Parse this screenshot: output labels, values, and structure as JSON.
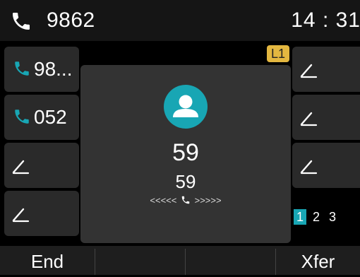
{
  "status_bar": {
    "extension": "9862",
    "time": "14 : 31"
  },
  "line_keys_left": [
    {
      "type": "phone",
      "label": "98..."
    },
    {
      "type": "phone",
      "label": "052"
    },
    {
      "type": "empty",
      "label": ""
    },
    {
      "type": "empty",
      "label": ""
    }
  ],
  "line_keys_right": [
    {
      "type": "empty",
      "label": ""
    },
    {
      "type": "empty",
      "label": ""
    },
    {
      "type": "empty",
      "label": ""
    }
  ],
  "call": {
    "line_badge": "L1",
    "caller_name": "59",
    "caller_number": "59",
    "ringing_left": "<<<<<",
    "ringing_right": ">>>>>"
  },
  "pages": [
    "1",
    "2",
    "3"
  ],
  "active_page": "1",
  "softkeys": {
    "key1": "End",
    "key2": "",
    "key3": "",
    "key4": "Xfer"
  },
  "colors": {
    "accent": "#18a6b4",
    "badge": "#e3b740",
    "background": "#000000",
    "key_background": "#2a2a2a"
  },
  "icons": [
    "phone-icon",
    "contact-avatar-icon",
    "edit-pen-icon",
    "ringing-phone-icon"
  ]
}
